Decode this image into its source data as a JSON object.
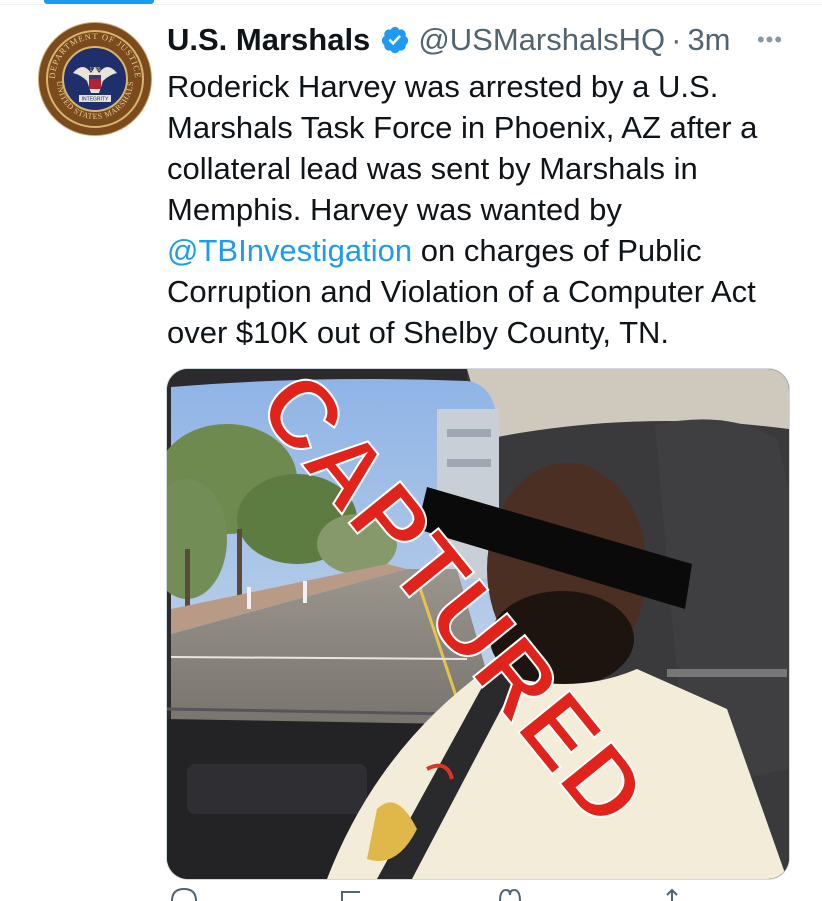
{
  "tweet": {
    "display_name": "U.S. Marshals",
    "handle": "@USMarshalsHQ",
    "separator": "·",
    "time": "3m",
    "more_label": "•••",
    "text_before_mention": "Roderick Harvey was arrested by a U.S. Marshals Task Force in Phoenix, AZ after a collateral lead was sent by Marshals in Memphis.  Harvey was wanted by ",
    "mention": "@TBInvestigation",
    "text_after_mention": " on charges of Public Corruption and Violation of a Computer Act over $10K out of Shelby County, TN.",
    "media": {
      "overlay_text": "CAPTURED",
      "overlay_color": "#e0231b"
    }
  },
  "avatar": {
    "seal_top_text": "DEPARTMENT OF JUSTICE",
    "seal_bottom_text": "UNITED STATES MARSHALS",
    "seal_center_text": "INTEGRITY",
    "seal_year": "1789"
  },
  "actions": {
    "icons": [
      "reply-icon",
      "retweet-icon",
      "like-icon",
      "share-icon"
    ]
  },
  "colors": {
    "accent": "#1d9bf0",
    "text": "#0f1419",
    "secondary": "#536471"
  }
}
